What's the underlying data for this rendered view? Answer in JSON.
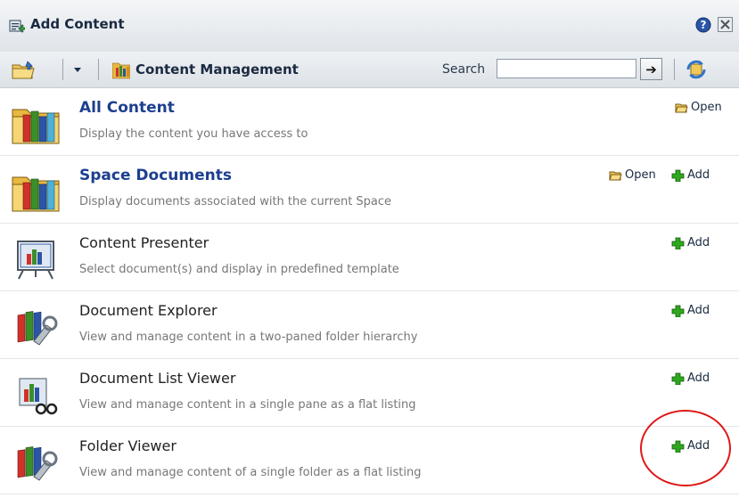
{
  "header": {
    "title": "Add Content"
  },
  "toolbar": {
    "breadcrumb": "Content Management",
    "search_label": "Search",
    "search_value": "",
    "go_label": "➔"
  },
  "items": [
    {
      "title": "All Content",
      "desc": "Display the content you have access to",
      "open": "Open",
      "add": ""
    },
    {
      "title": "Space Documents",
      "desc": "Display documents associated with the current Space",
      "open": "Open",
      "add": "Add"
    },
    {
      "title": "Content Presenter",
      "desc": "Select document(s) and display in predefined template",
      "open": "",
      "add": "Add"
    },
    {
      "title": "Document Explorer",
      "desc": "View and manage content in a two-paned folder hierarchy",
      "open": "",
      "add": "Add"
    },
    {
      "title": "Document List Viewer",
      "desc": "View and manage content in a single pane as a flat listing",
      "open": "",
      "add": "Add"
    },
    {
      "title": "Folder Viewer",
      "desc": "View and manage content of a single folder as a flat listing",
      "open": "",
      "add": "Add"
    }
  ],
  "icons": {
    "title": "add-content-icon",
    "help": "help-icon",
    "close": "close-icon",
    "folder": "folder-icon",
    "dropdown": "chevron-down-icon",
    "content_management": "content-management-icon",
    "refresh": "refresh-icon",
    "open": "open-folder-icon",
    "add": "add-plus-icon"
  },
  "colors": {
    "title_link": "#1d3f8f",
    "add_green": "#2ea81e",
    "annotation": "#e01818",
    "header_bg": "#dfe4e9"
  }
}
